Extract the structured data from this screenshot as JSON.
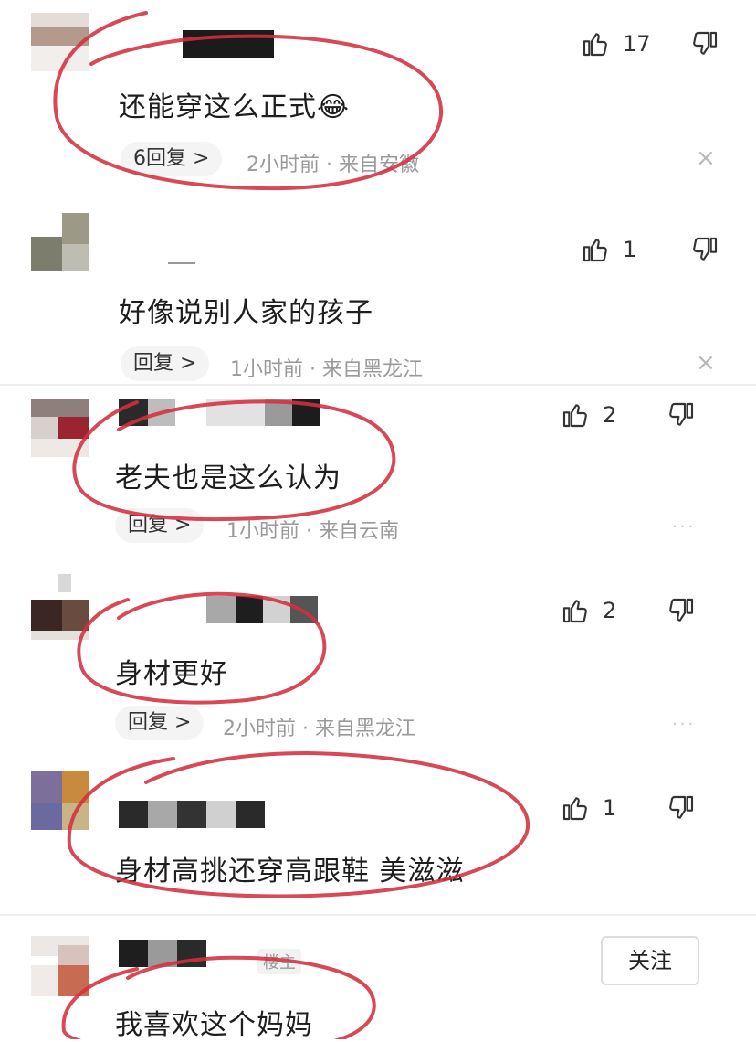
{
  "comments": [
    {
      "text": "还能穿这么正式😂",
      "likes": "17",
      "reply_label": "6回复 >",
      "time": "2小时前",
      "sep": "·",
      "location": "来自安徽"
    },
    {
      "text": "好像说别人家的孩子",
      "likes": "1",
      "reply_label": "回复 >",
      "time": "1小时前",
      "sep": "·",
      "location": "来自黑龙江"
    },
    {
      "text": "老夫也是这么认为",
      "likes": "2",
      "reply_label": "回复 >",
      "time": "1小时前",
      "sep": "·",
      "location": "来自云南"
    },
    {
      "text": "身材更好",
      "likes": "2",
      "reply_label": "回复 >",
      "time": "2小时前",
      "sep": "·",
      "location": "来自黑龙江"
    },
    {
      "text": "身材高挑还穿高跟鞋 美滋滋",
      "likes": "1"
    },
    {
      "text": "我喜欢这个妈妈",
      "author_tag": "楼主",
      "follow_label": "关注"
    }
  ],
  "icons": {
    "like": "thumbs-up-icon",
    "dislike": "thumbs-down-icon",
    "close": "close-icon",
    "more": "more-dots-icon"
  },
  "annotation_color": "#d32f3f"
}
